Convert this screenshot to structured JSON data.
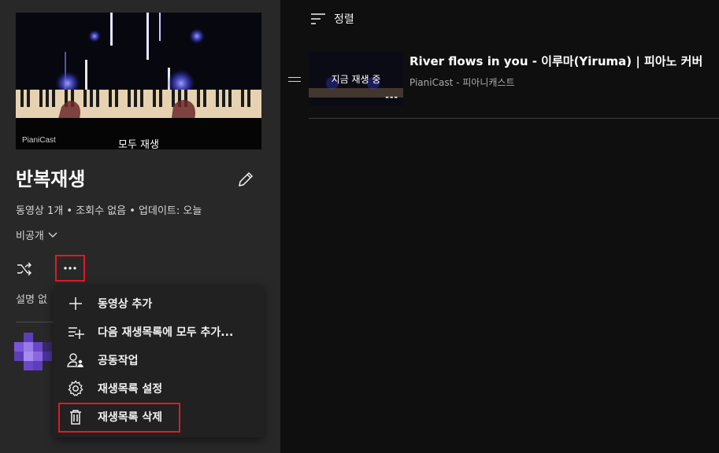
{
  "playlist": {
    "thumbnail": {
      "overlay_label": "모두 재생",
      "brand": "PianiCast"
    },
    "title": "반복재생",
    "meta": "동영상 1개 • 조회수 없음 • 업데이트: 오늘",
    "privacy": "비공개",
    "description": "설명 없",
    "icons": {
      "edit": "pencil-icon",
      "shuffle": "shuffle-icon",
      "more": "more-horizontal-icon",
      "privacy_dropdown": "chevron-down-icon"
    }
  },
  "menu": {
    "items": [
      {
        "label": "동영상 추가",
        "icon": "plus-icon"
      },
      {
        "label": "다음 재생목록에 모두 추가...",
        "icon": "playlist-add-icon"
      },
      {
        "label": "공동작업",
        "icon": "collaborate-icon"
      },
      {
        "label": "재생목록 설정",
        "icon": "gear-icon"
      },
      {
        "label": "재생목록 삭제",
        "icon": "trash-icon"
      }
    ]
  },
  "sort": {
    "label": "정렬",
    "icon": "sort-icon"
  },
  "videos": [
    {
      "title": "River flows in you - 이루마(Yiruma) | 피아노 커버",
      "channel": "PianiCast - 피아니캐스트",
      "status": "지금 재생 중",
      "duration_placeholder": "---"
    }
  ],
  "colors": {
    "background": "#0f0f0f",
    "panel": "#282828",
    "menu": "#212121",
    "highlight": "#e01b24",
    "glow": "#5a5cff"
  }
}
